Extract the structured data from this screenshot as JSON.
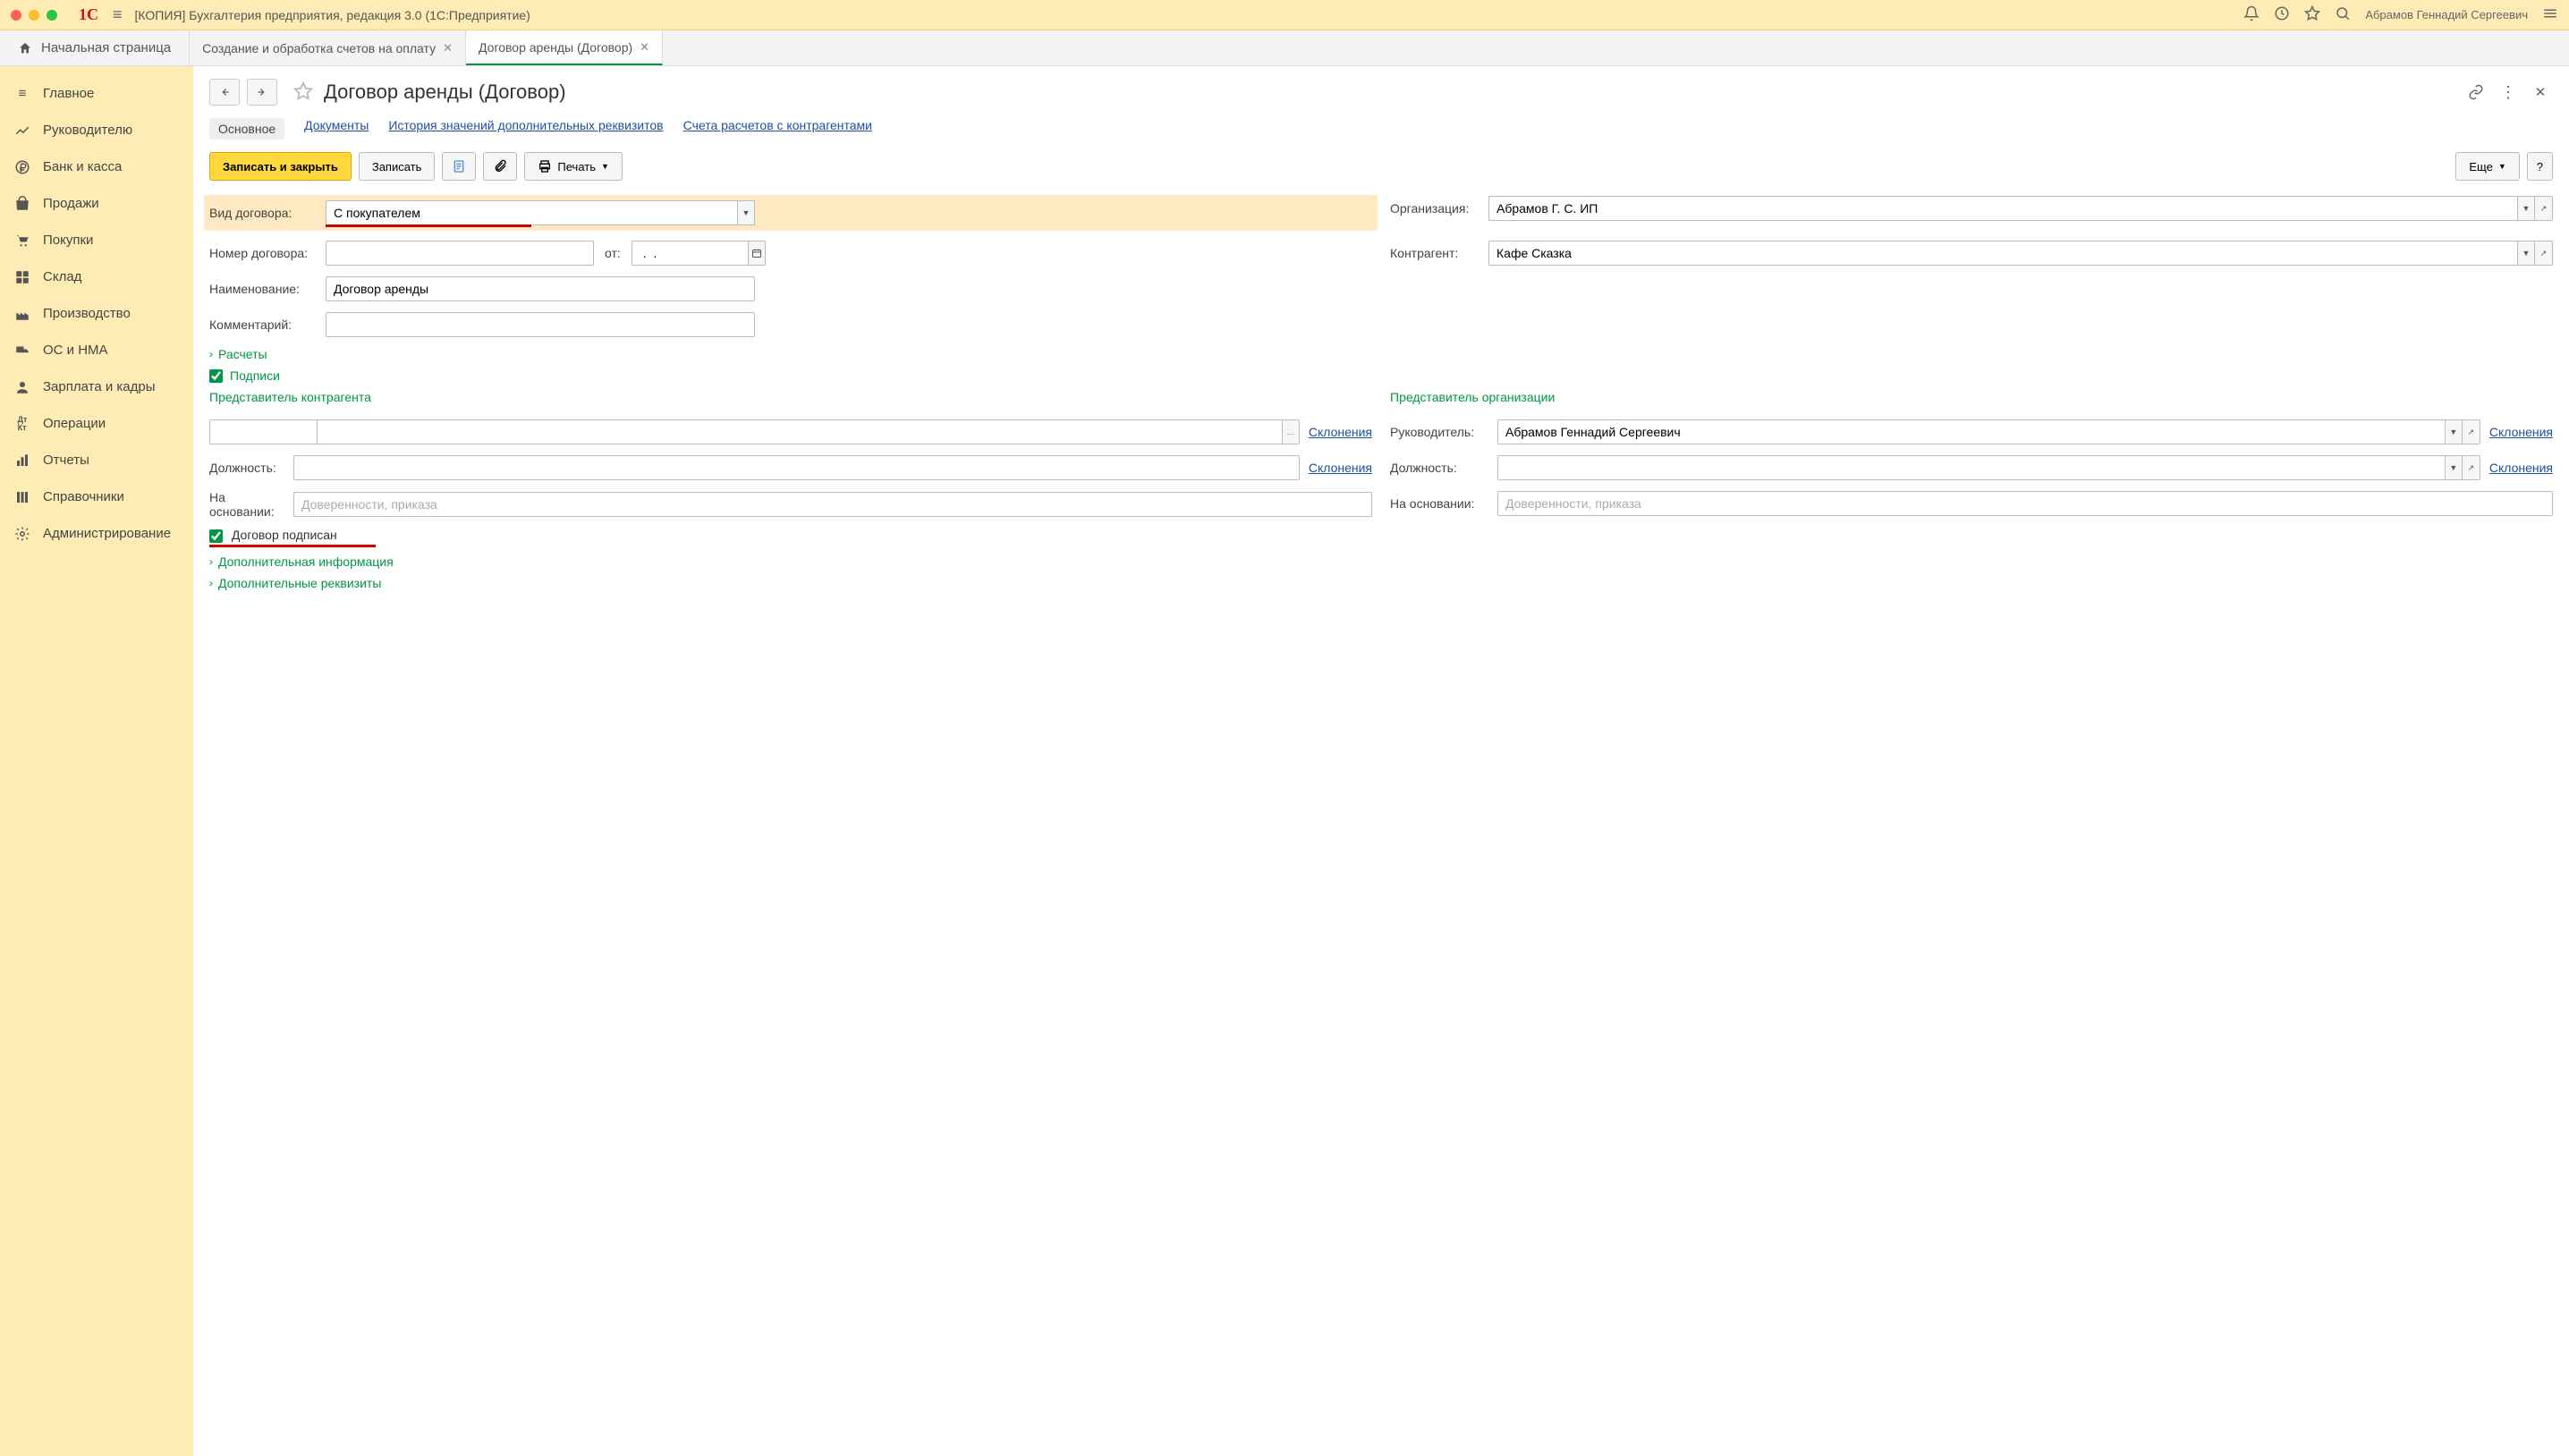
{
  "titlebar": {
    "title": "[КОПИЯ] Бухгалтерия предприятия, редакция 3.0  (1С:Предприятие)",
    "user": "Абрамов Геннадий Сергеевич"
  },
  "tabs": {
    "home": "Начальная страница",
    "t1": "Создание и обработка счетов на оплату",
    "t2": "Договор аренды (Договор)"
  },
  "sidebar": {
    "items": [
      {
        "label": "Главное",
        "icon": "menu"
      },
      {
        "label": "Руководителю",
        "icon": "trend"
      },
      {
        "label": "Банк и касса",
        "icon": "ruble"
      },
      {
        "label": "Продажи",
        "icon": "bag"
      },
      {
        "label": "Покупки",
        "icon": "cart"
      },
      {
        "label": "Склад",
        "icon": "boxes"
      },
      {
        "label": "Производство",
        "icon": "factory"
      },
      {
        "label": "ОС и НМА",
        "icon": "truck"
      },
      {
        "label": "Зарплата и кадры",
        "icon": "person"
      },
      {
        "label": "Операции",
        "icon": "dtkt"
      },
      {
        "label": "Отчеты",
        "icon": "bars"
      },
      {
        "label": "Справочники",
        "icon": "books"
      },
      {
        "label": "Администрирование",
        "icon": "gear"
      }
    ]
  },
  "page": {
    "title": "Договор аренды (Договор)"
  },
  "pills": {
    "main": "Основное",
    "docs": "Документы",
    "hist": "История значений дополнительных реквизитов",
    "accts": "Счета расчетов с контрагентами"
  },
  "toolbar": {
    "save_close": "Записать и закрыть",
    "save": "Записать",
    "print": "Печать",
    "more": "Еще",
    "help": "?"
  },
  "form": {
    "kind_label": "Вид договора:",
    "kind_value": "С покупателем",
    "org_label": "Организация:",
    "org_value": "Абрамов Г. С. ИП",
    "num_label": "Номер договора:",
    "num_value": "",
    "from_label": "от:",
    "date_value": " .  .    ",
    "ctr_label": "Контрагент:",
    "ctr_value": "Кафе Сказка",
    "name_label": "Наименование:",
    "name_value": "Договор аренды",
    "comment_label": "Комментарий:",
    "comment_value": "",
    "calc_section": "Расчеты",
    "sign_section": "Подписи",
    "rep_ctr": "Представитель контрагента",
    "rep_org": "Представитель организации",
    "pos_label": "Должность:",
    "basis_label": "На основании:",
    "basis_ph": "Доверенности, приказа",
    "lead_label": "Руководитель:",
    "lead_value": "Абрамов Геннадий Сергеевич",
    "skl": "Склонения",
    "signed": "Договор подписан",
    "addinfo": "Дополнительная информация",
    "addreq": "Дополнительные реквизиты"
  }
}
